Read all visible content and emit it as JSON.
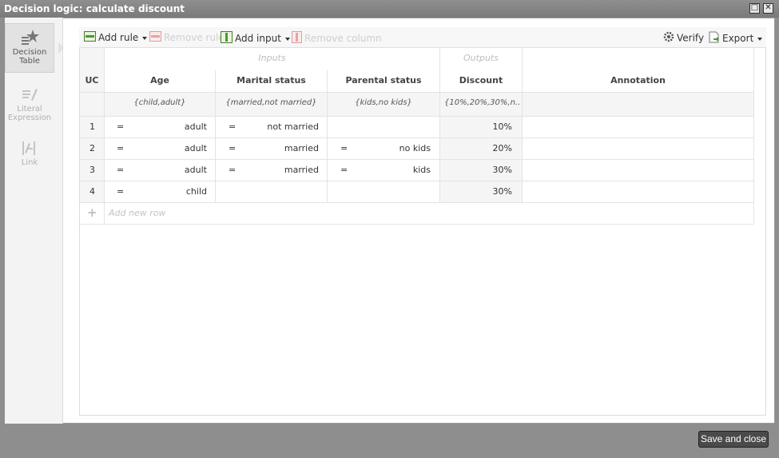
{
  "window": {
    "title": "Decision logic: calculate discount",
    "maximize_icon": "□",
    "close_icon": "✕"
  },
  "sidebar": {
    "items": [
      {
        "label_line1": "Decision",
        "label_line2": "Table",
        "active": true,
        "icon": "decision-table-icon"
      },
      {
        "label_line1": "Literal",
        "label_line2": "Expression",
        "active": false,
        "icon": "literal-expression-icon"
      },
      {
        "label_line1": "Link",
        "label_line2": "",
        "active": false,
        "icon": "link-icon"
      }
    ]
  },
  "toolbar": {
    "add_rule": "Add rule",
    "remove_rule": "Remove rule",
    "add_input": "Add input",
    "remove_column": "Remove column",
    "verify": "Verify",
    "export": "Export"
  },
  "table": {
    "group_inputs": "Inputs",
    "group_outputs": "Outputs",
    "headers": {
      "uc": "UC",
      "age": "Age",
      "marital": "Marital status",
      "parental": "Parental status",
      "discount": "Discount",
      "annotation": "Annotation"
    },
    "allowed": {
      "age": "{child,adult}",
      "marital": "{married,not married}",
      "parental": "{kids,no kids}",
      "discount": "{10%,20%,30%,n..."
    },
    "rows": [
      {
        "n": "1",
        "age_op": "=",
        "age": "adult",
        "mar_op": "=",
        "marital": "not married",
        "par_op": "",
        "parental": "",
        "discount": "10%"
      },
      {
        "n": "2",
        "age_op": "=",
        "age": "adult",
        "mar_op": "=",
        "marital": "married",
        "par_op": "=",
        "parental": "no kids",
        "discount": "20%"
      },
      {
        "n": "3",
        "age_op": "=",
        "age": "adult",
        "mar_op": "=",
        "marital": "married",
        "par_op": "=",
        "parental": "kids",
        "discount": "30%"
      },
      {
        "n": "4",
        "age_op": "=",
        "age": "child",
        "mar_op": "",
        "marital": "",
        "par_op": "",
        "parental": "",
        "discount": "30%"
      }
    ],
    "add_row_plus": "+",
    "add_row": "Add new row"
  },
  "footer": {
    "save_and_close": "Save and close"
  }
}
